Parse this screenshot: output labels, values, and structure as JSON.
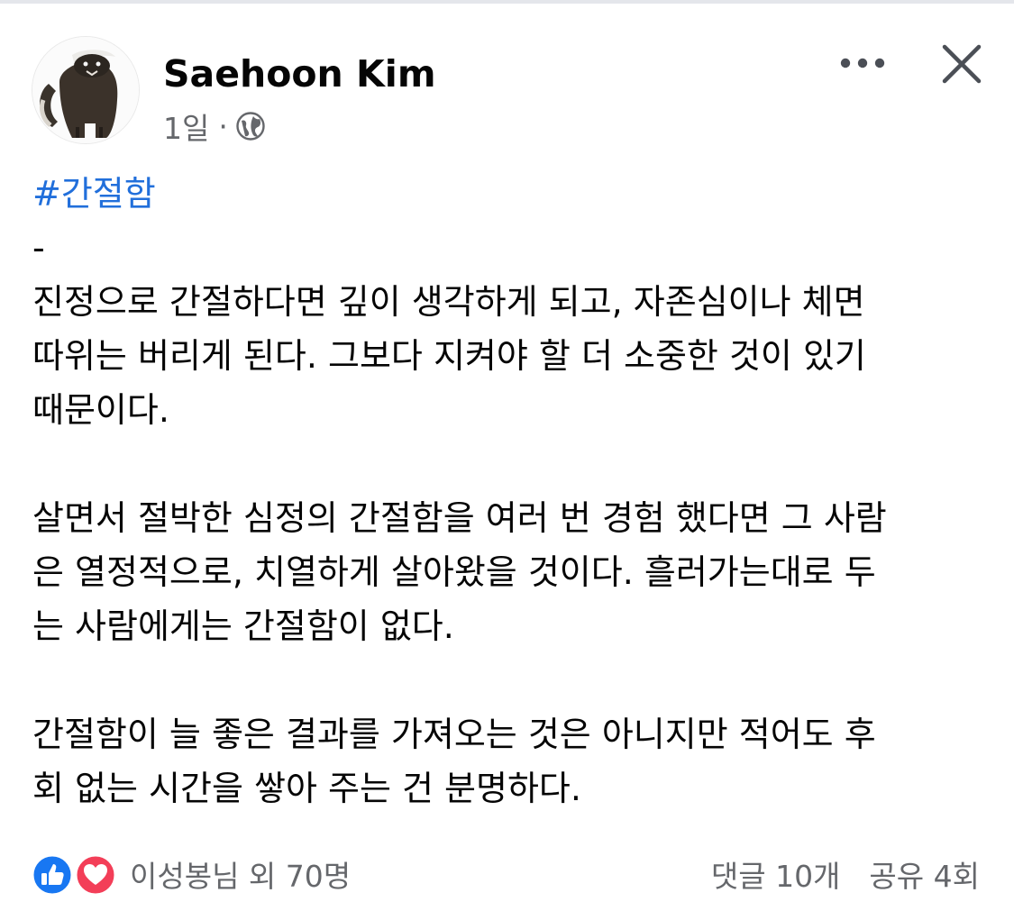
{
  "post": {
    "author": "Saehoon Kim",
    "time": "1일",
    "separator": "·",
    "privacy_icon": "globe-icon",
    "hashtag": "#간절함",
    "dash": "-",
    "body_lines": [
      "진정으로 간절하다면 깊이 생각하게 되고, 자존심이나 체면",
      "따위는 버리게 된다. 그보다 지켜야 할 더 소중한 것이 있기",
      "때문이다.",
      "",
      "살면서 절박한 심정의 간절함을 여러 번 경험 했다면 그 사람",
      "은 열정적으로, 치열하게 살아왔을 것이다. 흘러가는대로 두",
      "는 사람에게는 간절함이 없다.",
      "",
      "간절함이 늘 좋은 결과를 가져오는 것은 아니지만 적어도 후",
      "회 없는 시간을 쌓아 주는 건 분명하다."
    ]
  },
  "actions": {
    "more_icon": "more-horizontal-icon",
    "close_icon": "close-icon"
  },
  "footer": {
    "reactions_text": "이성봉님 외 70명",
    "comments": "댓글 10개",
    "shares": "공유 4회",
    "reaction_icons": [
      "like-icon",
      "love-icon"
    ]
  },
  "colors": {
    "hashtag": "#216fdb",
    "secondary_text": "#65676b",
    "like": "#1877f2",
    "love": "#f33e58"
  }
}
